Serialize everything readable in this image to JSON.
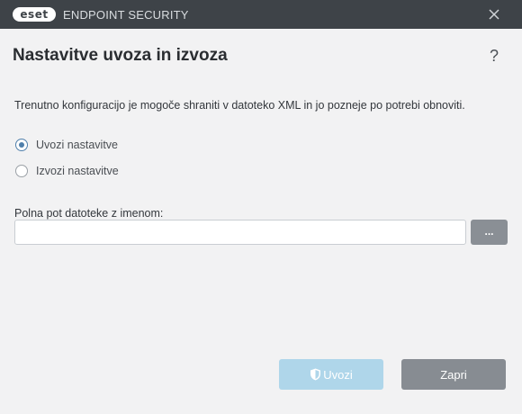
{
  "window": {
    "logo_text": "eset",
    "app_title": "ENDPOINT SECURITY"
  },
  "dialog": {
    "title": "Nastavitve uvoza in izvoza",
    "help_label": "?",
    "description": "Trenutno konfiguracijo je mogoče shraniti v datoteko XML in jo pozneje po potrebi obnoviti.",
    "options": [
      {
        "label": "Uvozi nastavitve",
        "selected": true
      },
      {
        "label": "Izvozi nastavitve",
        "selected": false
      }
    ],
    "path_label": "Polna pot datoteke z imenom:",
    "path_value": "",
    "browse_label": "...",
    "import_label": "Uvozi",
    "close_label": "Zapri"
  },
  "colors": {
    "titlebar": "#3e4348",
    "background": "#f2f2f3",
    "accent": "#4f7fab",
    "import_button_disabled": "#afd6ea",
    "close_button": "#878c92"
  },
  "icons": [
    "close-icon",
    "help-icon",
    "shield-icon"
  ]
}
